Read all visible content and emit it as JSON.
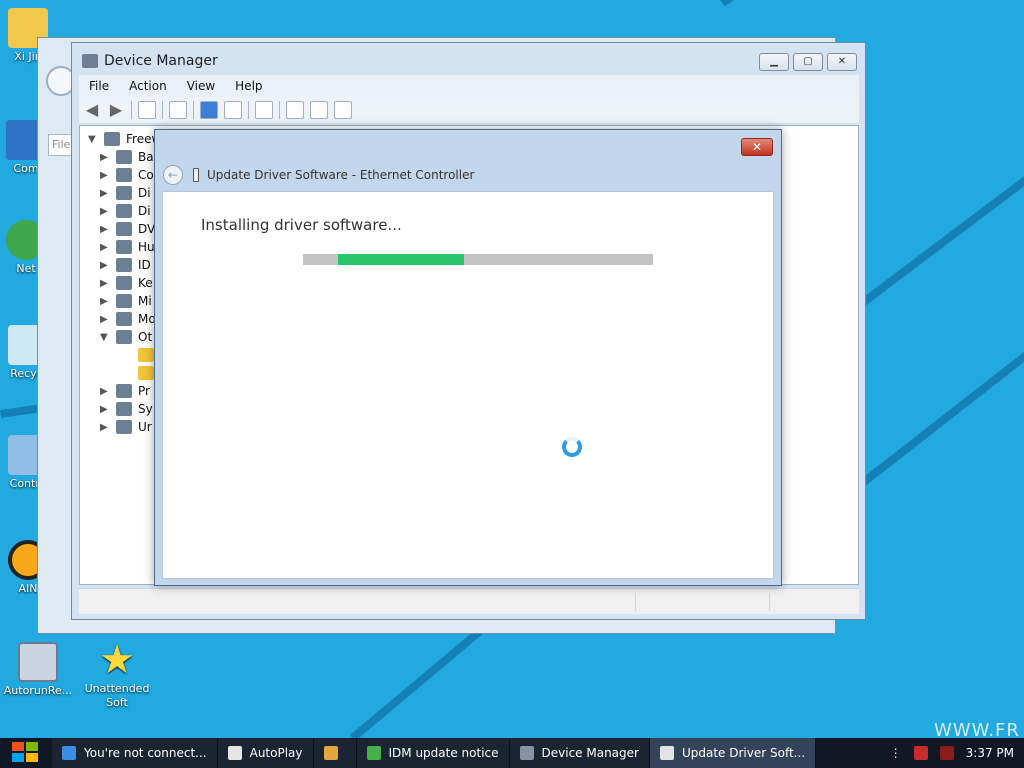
{
  "desktop": {
    "icons": [
      {
        "label": "Xi Jin",
        "name": "user-folder-icon"
      },
      {
        "label": "Com",
        "name": "computer-icon"
      },
      {
        "label": "Net",
        "name": "network-icon"
      },
      {
        "label": "Recycl",
        "name": "recycle-bin-icon"
      },
      {
        "label": "Contro",
        "name": "control-panel-icon"
      },
      {
        "label": "AIN",
        "name": "aimp-icon"
      },
      {
        "label": "AutorunRe...",
        "name": "autorun-icon"
      },
      {
        "label": "Unattended Soft",
        "name": "unattended-soft-icon"
      }
    ],
    "watermark": "WWW.FR"
  },
  "device_manager": {
    "title": "Device Manager",
    "menu": [
      "File",
      "Action",
      "View",
      "Help"
    ],
    "tree": {
      "root": "Freew",
      "items": [
        {
          "label": "Ba",
          "expanded": false
        },
        {
          "label": "Co",
          "expanded": false
        },
        {
          "label": "Di",
          "expanded": false
        },
        {
          "label": "Di",
          "expanded": false
        },
        {
          "label": "DV",
          "expanded": false
        },
        {
          "label": "Hu",
          "expanded": false
        },
        {
          "label": "ID",
          "expanded": false
        },
        {
          "label": "Ke",
          "expanded": false
        },
        {
          "label": "Mi",
          "expanded": false
        },
        {
          "label": "Mo",
          "expanded": false
        },
        {
          "label": "Ot",
          "expanded": true
        },
        {
          "label": "Pr",
          "expanded": false
        },
        {
          "label": "Sy",
          "expanded": false
        },
        {
          "label": "Ur",
          "expanded": false
        }
      ]
    },
    "ghost_address_label": "File"
  },
  "update_dialog": {
    "title": "Update Driver Software - Ethernet Controller",
    "heading": "Installing driver software...",
    "progress_fraction": 0.36
  },
  "taskbar": {
    "items": [
      {
        "label": "You're not connect...",
        "icon": "ie-icon",
        "active": false
      },
      {
        "label": "AutoPlay",
        "icon": "autoplay-icon",
        "active": false
      },
      {
        "label": "",
        "icon": "media-player-icon",
        "active": false
      },
      {
        "label": "IDM update notice",
        "icon": "idm-icon",
        "active": false
      },
      {
        "label": "Device Manager",
        "icon": "device-manager-icon",
        "active": false
      },
      {
        "label": "Update Driver Soft...",
        "icon": "update-driver-icon",
        "active": true
      }
    ],
    "time": "3:37 PM"
  },
  "colors": {
    "desktop": "#21a9e0",
    "accent": "#29c46b",
    "taskbar": "#111823"
  }
}
